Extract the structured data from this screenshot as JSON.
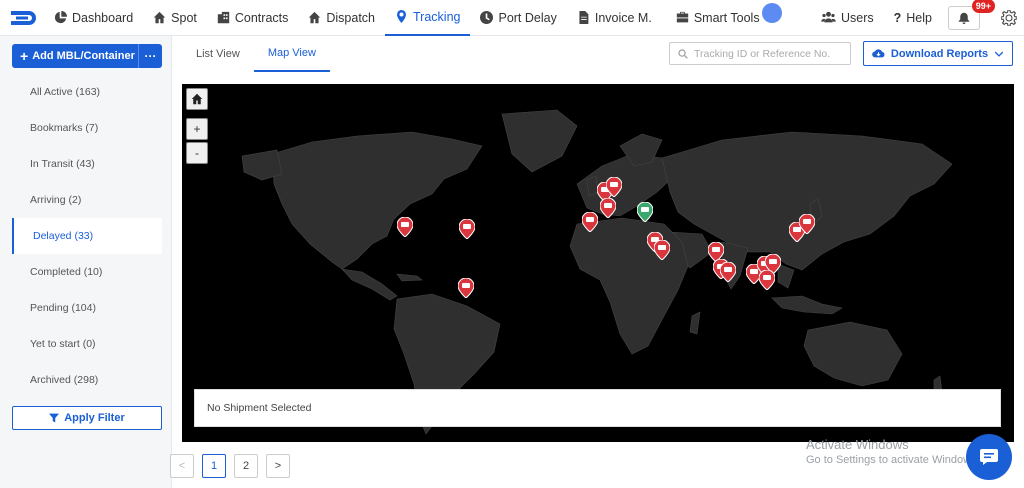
{
  "nav": {
    "items": [
      {
        "label": "Dashboard",
        "icon": "pie-chart-icon"
      },
      {
        "label": "Spot",
        "icon": "home-icon"
      },
      {
        "label": "Contracts",
        "icon": "building-icon"
      },
      {
        "label": "Dispatch",
        "icon": "home-icon"
      },
      {
        "label": "Tracking",
        "icon": "location-pin-icon"
      },
      {
        "label": "Port Delay",
        "icon": "clock-icon"
      },
      {
        "label": "Invoice M.",
        "icon": "file-icon"
      },
      {
        "label": "Smart Tools",
        "icon": "toolbox-icon"
      }
    ],
    "users_label": "Users",
    "help_label": "Help",
    "notifications_badge": "99+"
  },
  "sidebar": {
    "add_label": "Add  MBL/Container",
    "more_label": "···",
    "filters": [
      "All Active (163)",
      "Bookmarks (7)",
      "In Transit (43)",
      "Arriving (2)",
      "Delayed (33)",
      "Completed (10)",
      "Pending (104)",
      "Yet to start (0)",
      "Archived (298)"
    ],
    "active_filter_index": 4,
    "apply_filter_label": "Apply Filter"
  },
  "tabs": [
    "List View",
    "Map View"
  ],
  "active_tab": 1,
  "search": {
    "placeholder": "Tracking ID or Reference No.",
    "value": ""
  },
  "download_label": "Download Reports",
  "map": {
    "zoom_in": "+",
    "zoom_out": "-",
    "info_text": "No Shipment Selected"
  },
  "pagination": {
    "prev": "<",
    "pages": [
      "1",
      "2"
    ],
    "current": "1",
    "next": ">"
  },
  "watermark": {
    "title": "Activate Windows",
    "subtitle": "Go to Settings to activate Windows."
  },
  "colors": {
    "accent": "#1a5fd6",
    "delayed_pin": "#d9363e",
    "ok_pin": "#3aa76d",
    "land": "#2f2f2f"
  }
}
